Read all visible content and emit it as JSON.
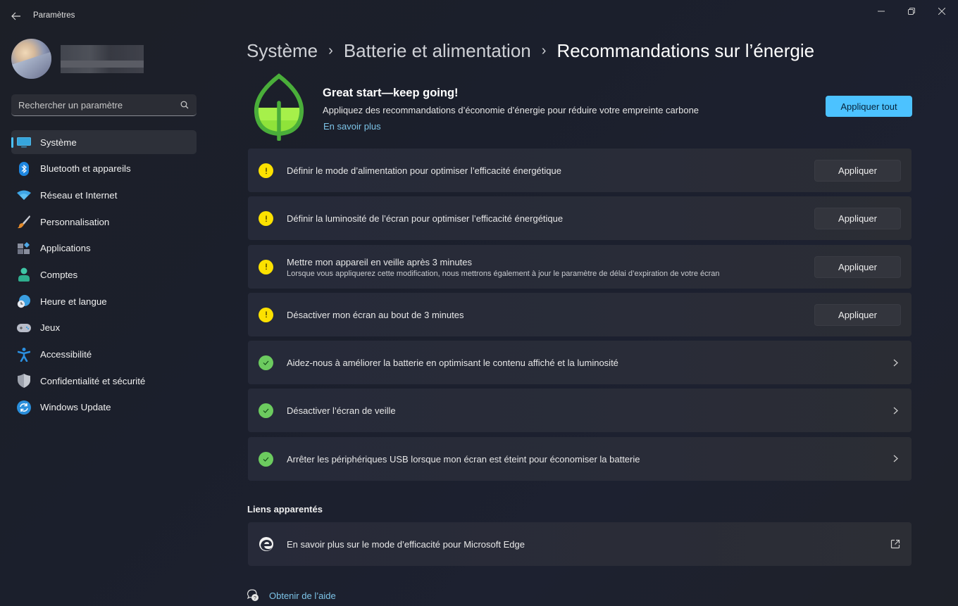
{
  "window": {
    "title": "Paramètres",
    "controls": [
      "minimize",
      "maximize",
      "close"
    ]
  },
  "profile": {
    "name_obscured": true
  },
  "search": {
    "placeholder": "Rechercher un paramètre",
    "value": ""
  },
  "sidebar": {
    "items": [
      {
        "label": "Système",
        "icon": "monitor-icon",
        "active": true
      },
      {
        "label": "Bluetooth et appareils",
        "icon": "bluetooth-icon",
        "active": false
      },
      {
        "label": "Réseau et Internet",
        "icon": "wifi-icon",
        "active": false
      },
      {
        "label": "Personnalisation",
        "icon": "paintbrush-icon",
        "active": false
      },
      {
        "label": "Applications",
        "icon": "apps-icon",
        "active": false
      },
      {
        "label": "Comptes",
        "icon": "person-icon",
        "active": false
      },
      {
        "label": "Heure et langue",
        "icon": "globe-clock-icon",
        "active": false
      },
      {
        "label": "Jeux",
        "icon": "gamepad-icon",
        "active": false
      },
      {
        "label": "Accessibilité",
        "icon": "accessibility-icon",
        "active": false
      },
      {
        "label": "Confidentialité et sécurité",
        "icon": "shield-icon",
        "active": false
      },
      {
        "label": "Windows Update",
        "icon": "update-icon",
        "active": false
      }
    ]
  },
  "breadcrumb": {
    "items": [
      "Système",
      "Batterie et alimentation"
    ],
    "current": "Recommandations sur l’énergie",
    "separator": "›"
  },
  "hero": {
    "title": "Great start—keep going!",
    "description": "Appliquez des recommandations d’économie d’énergie pour réduire votre empreinte carbone",
    "link": "En savoir plus",
    "apply_all": "Appliquer tout",
    "leaf_fill_fraction": 0.45
  },
  "recommendations": [
    {
      "text": "Définir le mode d’alimentation pour optimiser l’efficacité énergétique",
      "status": "warning",
      "action": "Appliquer"
    },
    {
      "text": "Définir la luminosité de l’écran pour optimiser l’efficacité énergétique",
      "status": "warning",
      "action": "Appliquer"
    },
    {
      "text": "Mettre mon appareil en veille après 3 minutes",
      "subtext": "Lorsque vous appliquerez cette modification, nous mettrons également à jour le paramètre de délai d’expiration de votre écran",
      "status": "warning",
      "action": "Appliquer"
    },
    {
      "text": "Désactiver mon écran au bout de 3 minutes",
      "status": "warning",
      "action": "Appliquer"
    },
    {
      "text": "Aidez-nous à améliorer la batterie en optimisant le contenu affiché et la luminosité",
      "status": "done"
    },
    {
      "text": "Désactiver l’écran de veille",
      "status": "done"
    },
    {
      "text": "Arrêter les périphériques USB lorsque mon écran est éteint pour économiser la batterie",
      "status": "done"
    }
  ],
  "related": {
    "title": "Liens apparentés",
    "links": [
      {
        "text": "En savoir plus sur le mode d’efficacité pour Microsoft Edge",
        "icon": "edge-icon"
      }
    ]
  },
  "help": {
    "text": "Obtenir de l’aide"
  },
  "colors": {
    "accent": "#4cc2ff",
    "warning": "#fce100",
    "success": "#6ccb5f",
    "link": "#7dc4e8"
  }
}
